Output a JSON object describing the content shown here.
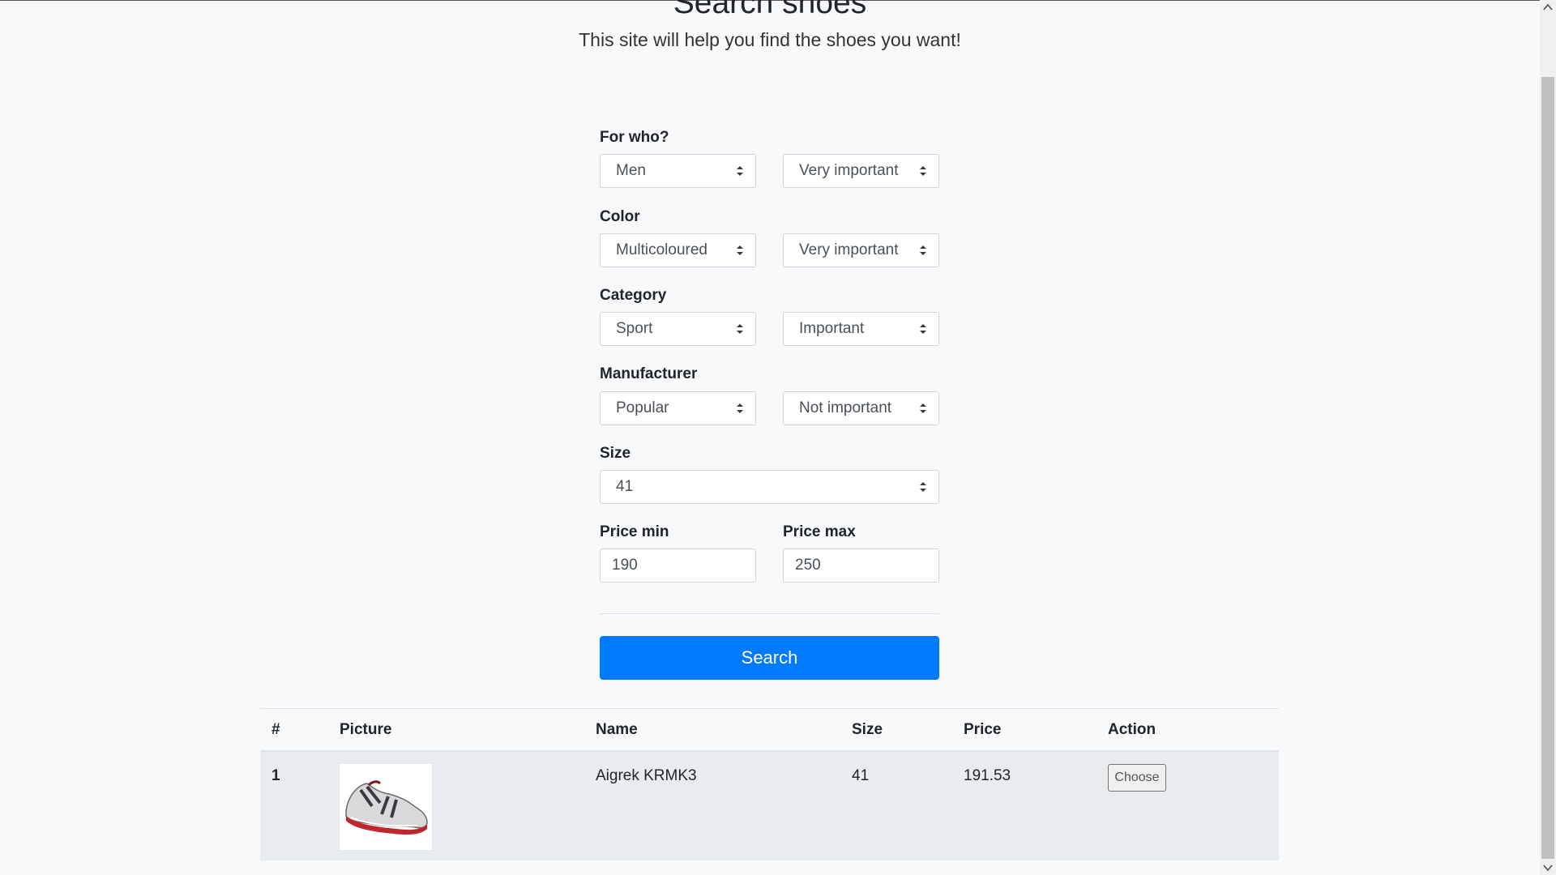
{
  "header": {
    "title": "Search shoes",
    "lead": "This site will help you find the shoes you want!"
  },
  "form": {
    "for_who": {
      "label": "For who?",
      "value": "Men",
      "importance": "Very important"
    },
    "color": {
      "label": "Color",
      "value": "Multicoloured",
      "importance": "Very important"
    },
    "category": {
      "label": "Category",
      "value": "Sport",
      "importance": "Important"
    },
    "manufacturer": {
      "label": "Manufacturer",
      "value": "Popular",
      "importance": "Not important"
    },
    "size": {
      "label": "Size",
      "value": "41"
    },
    "price_min": {
      "label": "Price min",
      "value": "190"
    },
    "price_max": {
      "label": "Price max",
      "value": "250"
    },
    "search_label": "Search"
  },
  "results": {
    "columns": [
      "#",
      "Picture",
      "Name",
      "Size",
      "Price",
      "Action"
    ],
    "rows": [
      {
        "index": "1",
        "name": "Aigrek KRMK3",
        "size": "41",
        "price": "191.53",
        "action": "Choose"
      }
    ]
  },
  "colors": {
    "primary": "#007bff",
    "background": "#f8f9fa",
    "row_background": "#e9ecef"
  }
}
